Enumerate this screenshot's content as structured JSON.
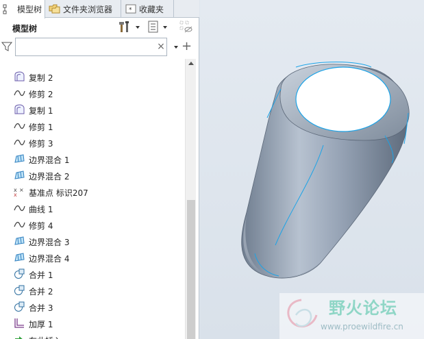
{
  "tabs": [
    {
      "label": "模型树",
      "icon": "model-tree-icon",
      "active": true
    },
    {
      "label": "文件夹浏览器",
      "icon": "folder-browser-icon",
      "active": false
    },
    {
      "label": "收藏夹",
      "icon": "favorites-icon",
      "active": false
    }
  ],
  "panel": {
    "title": "模型树"
  },
  "toolbar": {
    "settings_icon": "tools-icon",
    "show_icon": "list-view-icon",
    "filter_off_icon": "hidden-items-icon"
  },
  "search": {
    "value": "",
    "placeholder": "",
    "clear_symbol": "×",
    "add_symbol": "+"
  },
  "tree": {
    "items": [
      {
        "label": "",
        "icon": "partial-icon"
      },
      {
        "label": "复制 2",
        "icon": "copy-surface-icon"
      },
      {
        "label": "修剪 2",
        "icon": "trim-icon"
      },
      {
        "label": "复制 1",
        "icon": "copy-surface-icon"
      },
      {
        "label": "修剪 1",
        "icon": "trim-icon"
      },
      {
        "label": "修剪 3",
        "icon": "trim-icon"
      },
      {
        "label": "边界混合 1",
        "icon": "boundary-blend-icon"
      },
      {
        "label": "边界混合 2",
        "icon": "boundary-blend-icon"
      },
      {
        "label": "基准点 标识207",
        "icon": "datum-point-icon"
      },
      {
        "label": "曲线 1",
        "icon": "trim-icon"
      },
      {
        "label": "修剪 4",
        "icon": "trim-icon"
      },
      {
        "label": "边界混合 3",
        "icon": "boundary-blend-icon"
      },
      {
        "label": "边界混合 4",
        "icon": "boundary-blend-icon"
      },
      {
        "label": "合并 1",
        "icon": "merge-icon"
      },
      {
        "label": "合并 2",
        "icon": "merge-icon"
      },
      {
        "label": "合并 3",
        "icon": "merge-icon"
      },
      {
        "label": "加厚 1",
        "icon": "thicken-icon"
      },
      {
        "label": "在此插入",
        "icon": "insert-here-arrow-icon"
      }
    ]
  },
  "viewport": {
    "model": "3d-thickened-surface-model"
  },
  "watermark": {
    "title": "野火论坛",
    "url": "www.proewildfire.cn"
  },
  "colors": {
    "accent": "#2f7fbf",
    "edge_highlight": "#1aa3e8",
    "model_fill": "#8f9db0"
  }
}
